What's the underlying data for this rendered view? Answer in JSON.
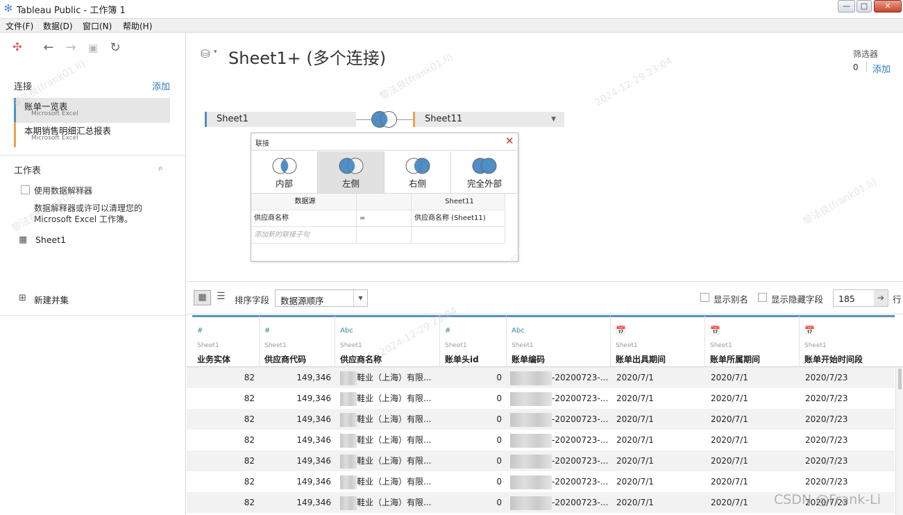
{
  "window": {
    "title": "Tableau Public - 工作簿 1",
    "controls": [
      "—",
      "□",
      "✕"
    ]
  },
  "menu": [
    "文件(F)",
    "数据(D)",
    "窗口(N)",
    "帮助(H)"
  ],
  "left": {
    "connections_title": "连接",
    "connections_add": "添加",
    "connections": [
      {
        "name": "账单一览表",
        "type": "Microsoft Excel",
        "color": "#4e8fc7",
        "selected": true
      },
      {
        "name": "本期销售明细汇总报表",
        "type": "Microsoft Excel",
        "color": "#f0a04b",
        "selected": false
      }
    ],
    "worksheet_title": "工作表",
    "interpreter_label": "使用数据解释器",
    "interpreter_desc_1": "数据解释器或许可以清理您的",
    "interpreter_desc_2": "Microsoft Excel 工作簿。",
    "sheets": [
      "Sheet1"
    ],
    "new_union": "新建并集"
  },
  "canvas": {
    "title": "Sheet1+ (多个连接)",
    "filters_label": "筛选器",
    "filters_count": "0",
    "filters_add": "添加",
    "left_table": "Sheet1",
    "right_table": "Sheet11"
  },
  "join": {
    "title": "联接",
    "types": [
      "内部",
      "左侧",
      "右侧",
      "完全外部"
    ],
    "selected": "左侧",
    "header_left": "数据源",
    "header_right": "Sheet11",
    "clause_left": "供应商名称",
    "clause_op": "=",
    "clause_right": "供应商名称 (Sheet11)",
    "add_clause_placeholder": "添加新的联接子句"
  },
  "grid_toolbar": {
    "sort_label": "排序字段",
    "sort_value": "数据源顺序",
    "show_alias": "显示别名",
    "show_hidden": "显示隐藏字段",
    "rows_value": "185",
    "rows_label": "行"
  },
  "columns": [
    {
      "type": "#",
      "source": "Sheet1",
      "name": "业务实体"
    },
    {
      "type": "#",
      "source": "Sheet1",
      "name": "供应商代码"
    },
    {
      "type": "Abc",
      "source": "Sheet1",
      "name": "供应商名称"
    },
    {
      "type": "#",
      "source": "Sheet1",
      "name": "账单头id"
    },
    {
      "type": "Abc",
      "source": "Sheet1",
      "name": "账单编码"
    },
    {
      "type": "cal",
      "source": "Sheet1",
      "name": "账单出具期间"
    },
    {
      "type": "cal",
      "source": "Sheet1",
      "name": "账单所属期间"
    },
    {
      "type": "cal",
      "source": "Sheet1",
      "name": "账单开始时间段"
    }
  ],
  "rows": [
    [
      "82",
      "149,346",
      "鞋业（上海）有限...",
      "0",
      "-20200723-...",
      "2020/7/1",
      "2020/7/1",
      "2020/7/23"
    ],
    [
      "82",
      "149,346",
      "鞋业（上海）有限...",
      "0",
      "-20200723-...",
      "2020/7/1",
      "2020/7/1",
      "2020/7/23"
    ],
    [
      "82",
      "149,346",
      "鞋业（上海）有限...",
      "0",
      "-20200723-...",
      "2020/7/1",
      "2020/7/1",
      "2020/7/23"
    ],
    [
      "82",
      "149,346",
      "鞋业（上海）有限...",
      "0",
      "-20200723-...",
      "2020/7/1",
      "2020/7/1",
      "2020/7/23"
    ],
    [
      "82",
      "149,346",
      "鞋业（上海）有限...",
      "0",
      "-20200723-...",
      "2020/7/1",
      "2020/7/1",
      "2020/7/23"
    ],
    [
      "82",
      "149,346",
      "鞋业（上海）有限...",
      "0",
      "-20200723-...",
      "2020/7/1",
      "2020/7/1",
      "2020/7/23"
    ],
    [
      "82",
      "149,346",
      "鞋业（上海）有限...",
      "0",
      "-20200723-...",
      "2020/7/1",
      "2020/7/1",
      "2020/7/23"
    ]
  ],
  "watermark": {
    "text_1": "黎法良(frank01.li)",
    "text_2": "2024-12-29 23:04",
    "csdn": "CSDN @Frank-Li"
  },
  "colors": {
    "accent_blue": "#4e8fc7",
    "accent_orange": "#f0a04b",
    "link": "#2d7ab8",
    "venn_fill": "#4e8fc7"
  }
}
